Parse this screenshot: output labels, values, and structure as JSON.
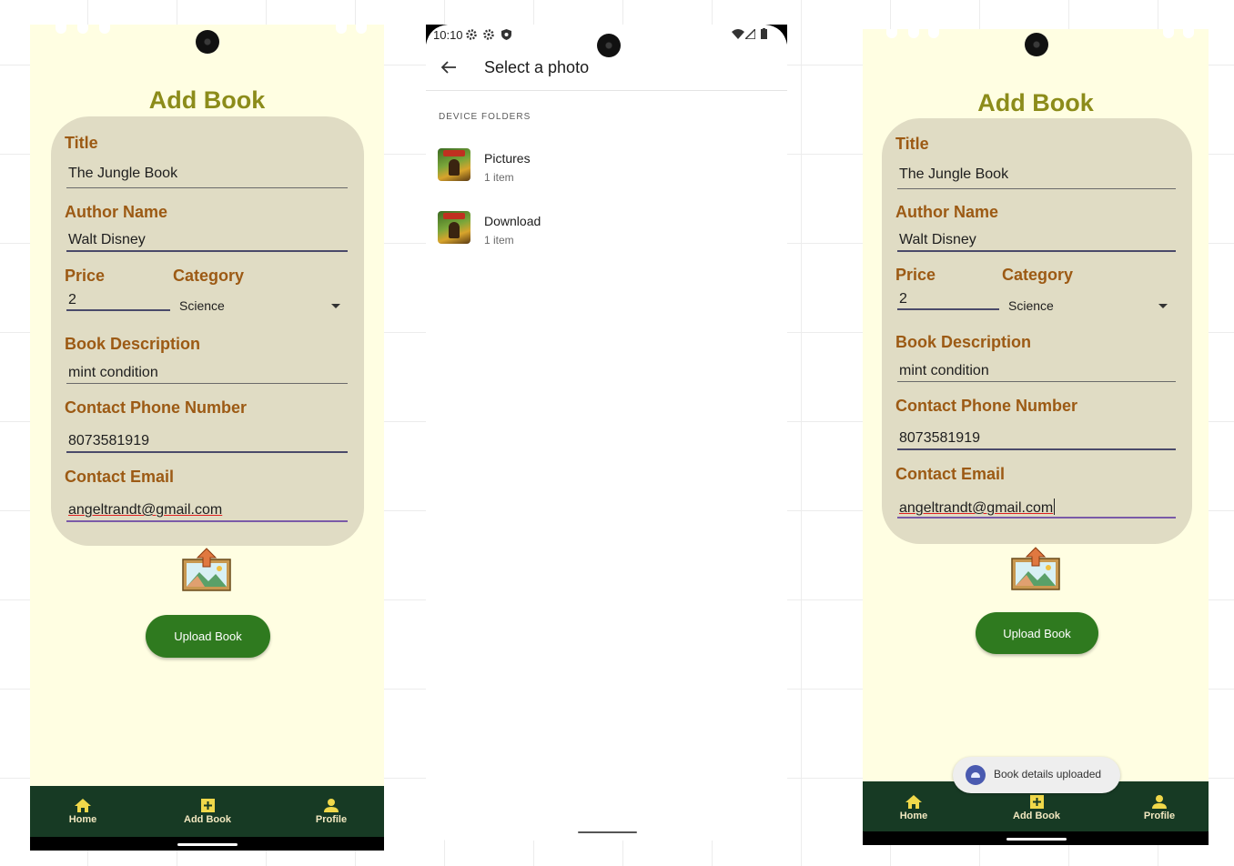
{
  "colors": {
    "screen_bg": "#fffee2",
    "heading": "#8c8c1a",
    "card_bg": "#e0dcc4",
    "field_label": "#9c5a14",
    "button": "#2f7a1f",
    "navbar": "#173a24",
    "nav_icon": "#f0d84a"
  },
  "form_left": {
    "heading": "Add Book",
    "title_label": "Title",
    "title_value": "The Jungle Book",
    "author_label": "Author Name",
    "author_value": "Walt Disney",
    "price_label": "Price",
    "price_value": "2",
    "category_label": "Category",
    "category_value": "Science",
    "description_label": "Book Description",
    "description_value": "mint condition",
    "phone_label": "Contact Phone Number",
    "phone_value": "8073581919",
    "email_label": "Contact Email",
    "email_value": "angeltrandt@gmail.com",
    "upload_icon": "image-upload-icon",
    "upload_button": "Upload Book",
    "nav": [
      {
        "label": "Home",
        "icon": "home-icon"
      },
      {
        "label": "Add Book",
        "icon": "add-box-icon"
      },
      {
        "label": "Profile",
        "icon": "person-icon"
      }
    ]
  },
  "picker": {
    "status_time": "10:10",
    "status_icons": [
      "gear-icon",
      "gear-icon",
      "shield-icon",
      "wifi-icon",
      "signal-icon",
      "battery-icon"
    ],
    "back_icon": "arrow-back-icon",
    "title": "Select a photo",
    "section": "DEVICE FOLDERS",
    "folders": [
      {
        "name": "Pictures",
        "count": "1 item"
      },
      {
        "name": "Download",
        "count": "1 item"
      }
    ]
  },
  "form_right": {
    "heading": "Add Book",
    "title_label": "Title",
    "title_value": "The Jungle Book",
    "author_label": "Author Name",
    "author_value": "Walt Disney",
    "price_label": "Price",
    "price_value": "2",
    "category_label": "Category",
    "category_value": "Science",
    "description_label": "Book Description",
    "description_value": "mint condition",
    "phone_label": "Contact Phone Number",
    "phone_value": "8073581919",
    "email_label": "Contact Email",
    "email_value": "angeltrandt@gmail.com",
    "upload_icon": "image-upload-icon",
    "upload_button": "Upload Book",
    "toast": "Book details uploaded",
    "nav": [
      {
        "label": "Home",
        "icon": "home-icon"
      },
      {
        "label": "Add Book",
        "icon": "add-box-icon"
      },
      {
        "label": "Profile",
        "icon": "person-icon"
      }
    ]
  }
}
